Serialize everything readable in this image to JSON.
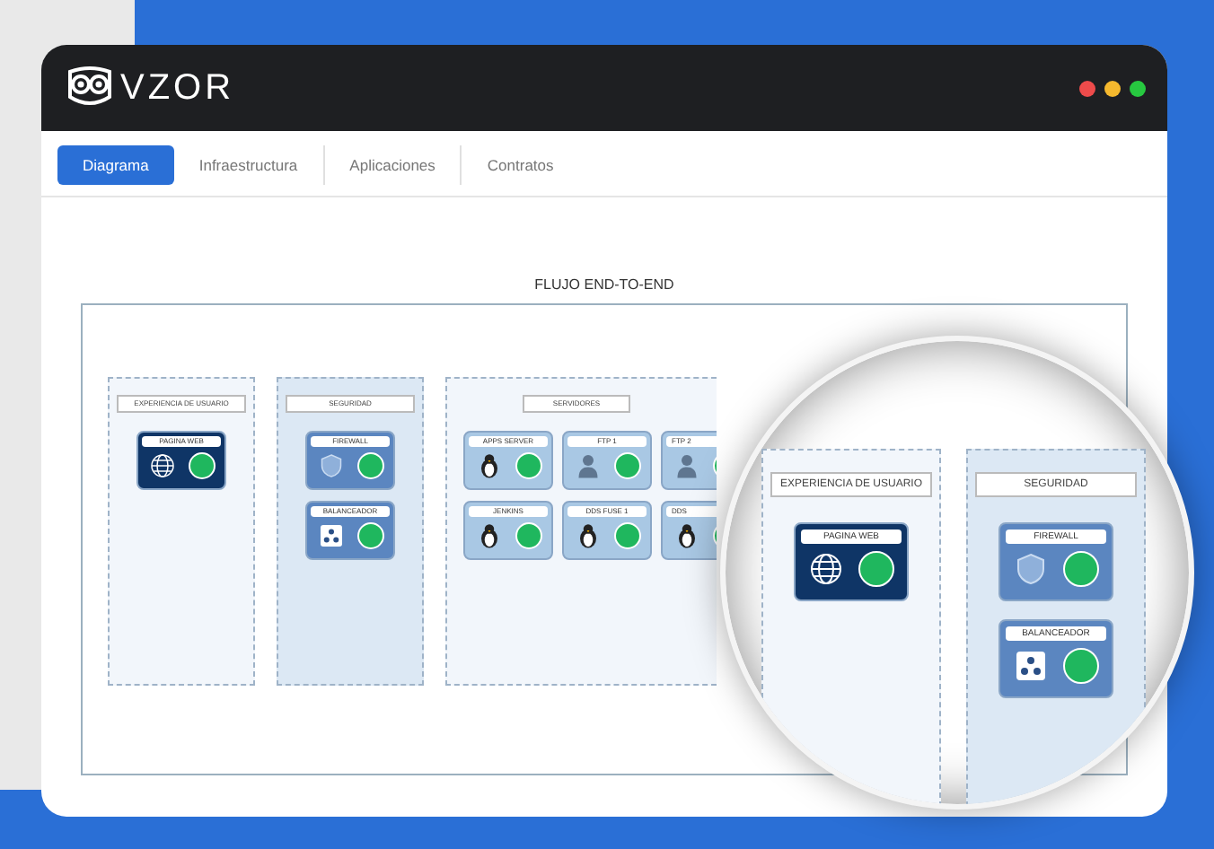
{
  "app": {
    "logo": "VZOR"
  },
  "tabs": [
    {
      "label": "Diagrama",
      "selected": true
    },
    {
      "label": "Infraestructura",
      "selected": false
    },
    {
      "label": "Aplicaciones",
      "selected": false
    },
    {
      "label": "Contratos",
      "selected": false
    }
  ],
  "diagram": {
    "title": "FLUJO END-TO-END",
    "groups": [
      {
        "title": "EXPERIENCIA DE USUARIO",
        "kind": "plain",
        "nodes": [
          {
            "label": "PAGINA WEB",
            "kind": "web"
          }
        ]
      },
      {
        "title": "SEGURIDAD",
        "kind": "shaded",
        "nodes": [
          {
            "label": "FIREWALL",
            "kind": "firewall"
          },
          {
            "label": "BALANCEADOR",
            "kind": "balancer"
          }
        ]
      },
      {
        "title": "SERVIDORES",
        "kind": "cut",
        "nodes": [
          {
            "label": "APPS SERVER",
            "kind": "linux"
          },
          {
            "label": "FTP 1",
            "kind": "admin"
          },
          {
            "label": "FTP 2",
            "kind": "admin"
          },
          {
            "label": "JENKINS",
            "kind": "linux"
          },
          {
            "label": "DDS FUSE 1",
            "kind": "linux"
          },
          {
            "label": "DDS",
            "kind": "linux"
          }
        ]
      }
    ]
  },
  "magnifier": {
    "groups": [
      {
        "title": "EXPERIENCIA DE USUARIO",
        "kind": "plain",
        "nodes": [
          {
            "label": "PAGINA WEB",
            "kind": "web"
          }
        ]
      },
      {
        "title": "SEGURIDAD",
        "kind": "shaded",
        "nodes": [
          {
            "label": "FIREWALL",
            "kind": "firewall"
          },
          {
            "label": "BALANCEADOR",
            "kind": "balancer"
          }
        ]
      }
    ]
  }
}
